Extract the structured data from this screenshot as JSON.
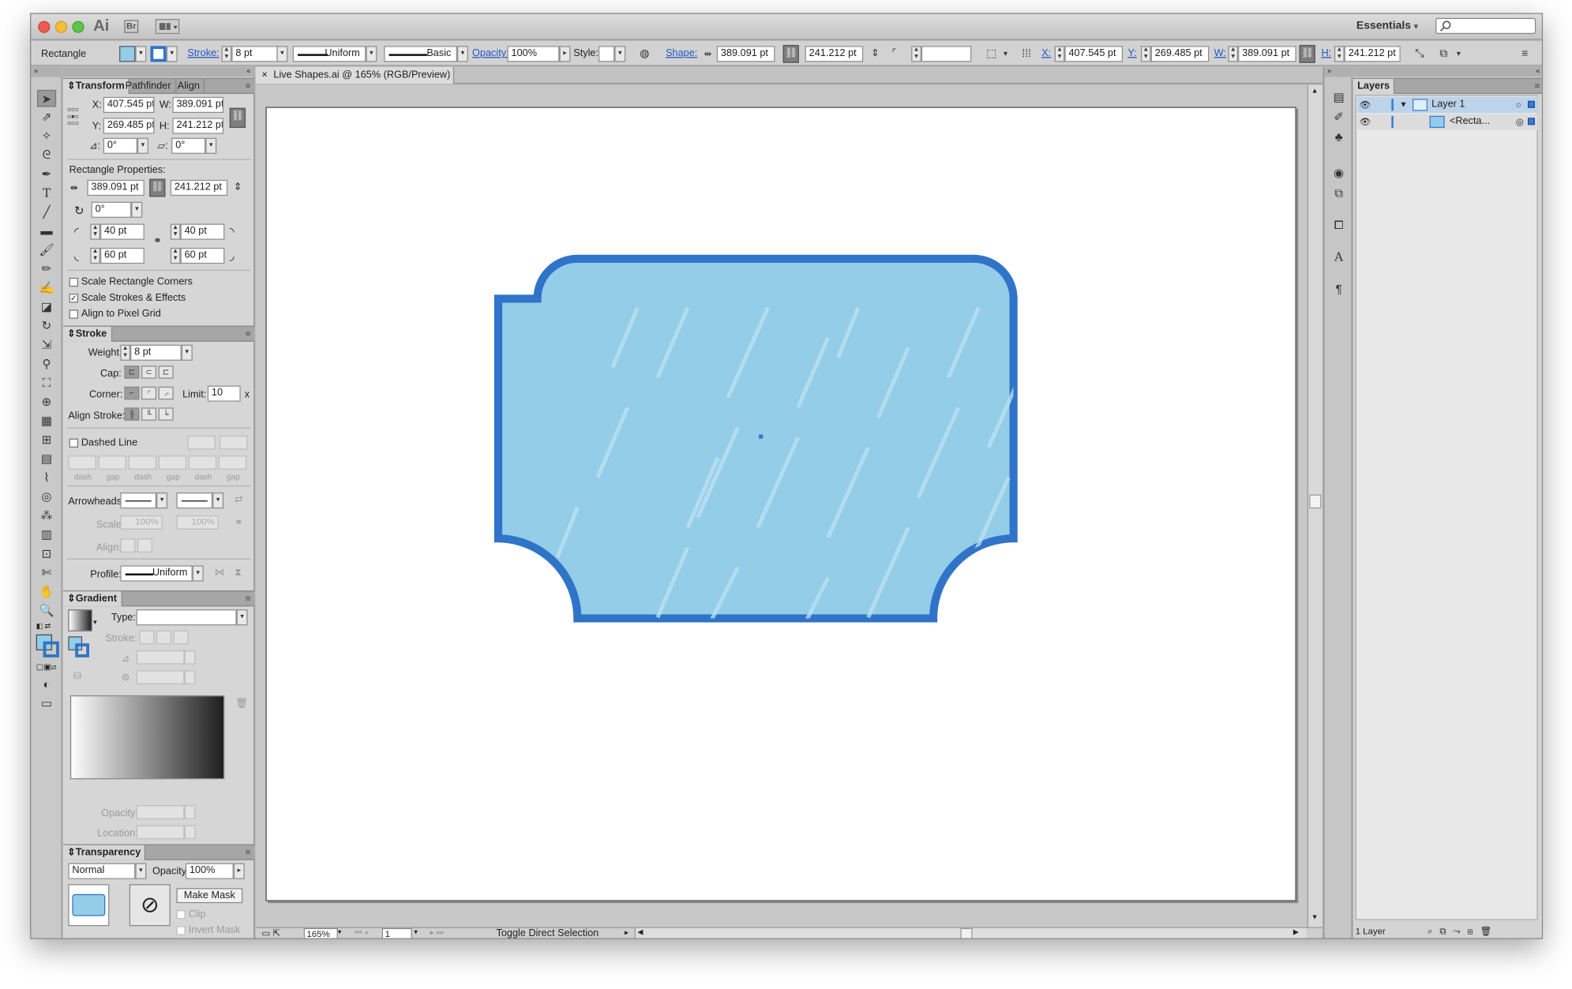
{
  "app": {
    "logo": "Ai",
    "bridge_logo": "Br",
    "workspace": "Essentials",
    "document_tab": "Live Shapes.ai @ 165% (RGB/Preview)"
  },
  "control_bar": {
    "selection_label": "Rectangle",
    "stroke_label": "Stroke:",
    "stroke_weight": "8 pt",
    "profile": "Uniform",
    "brush": "Basic",
    "opacity_label": "Opacity:",
    "opacity": "100%",
    "style_label": "Style:",
    "shape_label": "Shape:",
    "shape_w": "389.091 pt",
    "shape_h": "241.212 pt",
    "x_label": "X:",
    "x": "407.545 pt",
    "y_label": "Y:",
    "y": "269.485 pt",
    "w_label": "W:",
    "w": "389.091 pt",
    "h_label": "H:",
    "h": "241.212 pt"
  },
  "transform_panel": {
    "tabs": [
      "Transform",
      "Pathfinder",
      "Align"
    ],
    "x_label": "X:",
    "x": "407.545 pt",
    "w_label": "W:",
    "w": "389.091 pt",
    "y_label": "Y:",
    "y": "269.485 pt",
    "h_label": "H:",
    "h": "241.212 pt",
    "angle": "0°",
    "shear": "0°",
    "rect_props_label": "Rectangle Properties:",
    "rect_w": "389.091 pt",
    "rect_h": "241.212 pt",
    "rotation": "0°",
    "corner_tl": "40 pt",
    "corner_tr": "40 pt",
    "corner_bl": "60 pt",
    "corner_br": "60 pt",
    "scale_corners": "Scale Rectangle Corners",
    "scale_strokes": "Scale Strokes & Effects",
    "align_pixel": "Align to Pixel Grid"
  },
  "stroke_panel": {
    "title": "Stroke",
    "weight_label": "Weight:",
    "weight": "8 pt",
    "cap_label": "Cap:",
    "corner_label": "Corner:",
    "limit_label": "Limit:",
    "limit": "10",
    "limit_unit": "x",
    "align_label": "Align Stroke:",
    "dashed_label": "Dashed Line",
    "dash_labels": [
      "dash",
      "gap",
      "dash",
      "gap",
      "dash",
      "gap"
    ],
    "arrowheads_label": "Arrowheads:",
    "scale_label": "Scale:",
    "scale1": "100%",
    "scale2": "100%",
    "align2_label": "Align:",
    "profile_label": "Profile:",
    "profile": "Uniform"
  },
  "gradient_panel": {
    "title": "Gradient",
    "type_label": "Type:",
    "stroke_label": "Stroke:",
    "opacity_label": "Opacity:",
    "location_label": "Location:"
  },
  "transparency_panel": {
    "title": "Transparency",
    "blend_mode": "Normal",
    "opacity_label": "Opacity:",
    "opacity": "100%",
    "make_mask": "Make Mask",
    "clip": "Clip",
    "invert_mask": "Invert Mask"
  },
  "status_bar": {
    "zoom": "165%",
    "page": "1",
    "status_text": "Toggle Direct Selection"
  },
  "layers_panel": {
    "title": "Layers",
    "layer_name": "Layer 1",
    "sublayer_name": "<Recta...",
    "count": "1 Layer"
  },
  "colors": {
    "shape_fill": "#93cde8",
    "shape_stroke": "#2f74c8",
    "selection_blue": "#2f74c8"
  }
}
